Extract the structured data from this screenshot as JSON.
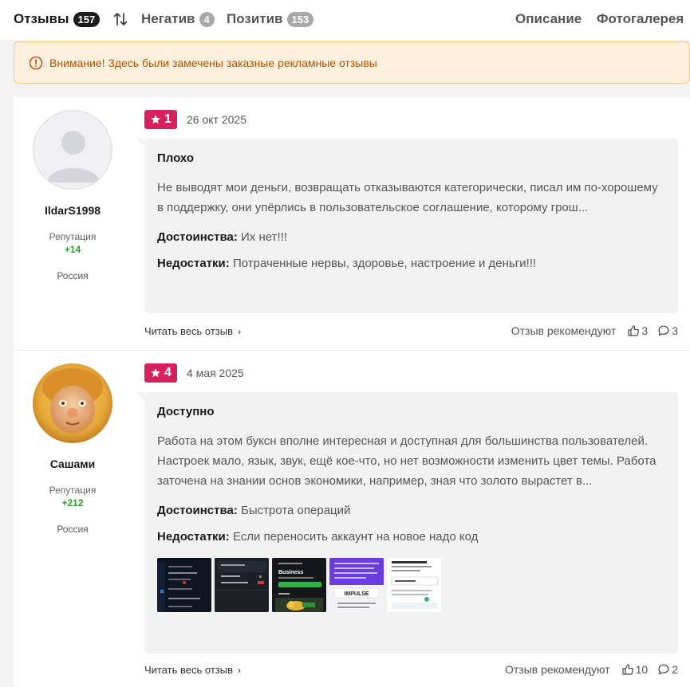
{
  "tabs": {
    "reviews_label": "Отзывы",
    "reviews_count": "157",
    "negative_label": "Негатив",
    "negative_count": "4",
    "positive_label": "Позитив",
    "positive_count": "153",
    "description_label": "Описание",
    "gallery_label": "Фотогалерея"
  },
  "warning": {
    "text": "Внимание! Здесь были замечены заказные рекламные отзывы"
  },
  "reviews": [
    {
      "author": "IldarS1998",
      "reputation_label": "Репутация",
      "reputation_value": "+14",
      "country": "Россия",
      "rating": "1",
      "date": "26 окт 2025",
      "title": "Плохо",
      "text": "Не выводят мои деньги, возвращать отказываются категорически, писал им по-хорошему в поддержку, они упёрлись в пользовательское соглашение, которому грош...",
      "pros_label": "Достоинства:",
      "pros": "Их нет!!!",
      "cons_label": "Недостатки:",
      "cons": "Потраченные нервы, здоровье, настроение и деньги!!!",
      "read_more": "Читать весь отзыв",
      "recommend_label": "Отзыв рекомендуют",
      "likes": "3",
      "comments": "3"
    },
    {
      "author": "Сашами",
      "reputation_label": "Репутация",
      "reputation_value": "+212",
      "country": "Россия",
      "rating": "4",
      "date": "4 мая 2025",
      "title": "Доступно",
      "text": "Работа на этом буксн вполне интересная и доступная для большинства пользователей. Настроек мало, язык, звук, ещё кое-что, но нет возможности изменить цвет темы. Работа заточена на знании основ экономики, например, зная что золото вырастет в...",
      "pros_label": "Достоинства:",
      "pros": "Быстрота операций",
      "cons_label": "Недостатки:",
      "cons": "Если переносить аккаунт на новое надо код",
      "read_more": "Читать весь отзыв",
      "recommend_label": "Отзыв рекомендуют",
      "likes": "10",
      "comments": "2",
      "thumbnails": [
        {
          "name": "screenshot-1",
          "text_lines": []
        },
        {
          "name": "screenshot-2",
          "text_lines": []
        },
        {
          "name": "screenshot-3",
          "text_lines": [
            "Business"
          ]
        },
        {
          "name": "screenshot-4",
          "text_lines": [
            "IMPULSE"
          ]
        },
        {
          "name": "screenshot-5",
          "text_lines": []
        }
      ]
    }
  ],
  "colors": {
    "rating_badge": "#d6215c",
    "reputation_positive": "#2ba12b",
    "warning_bg": "#fdf1de",
    "warning_text": "#b15100"
  }
}
